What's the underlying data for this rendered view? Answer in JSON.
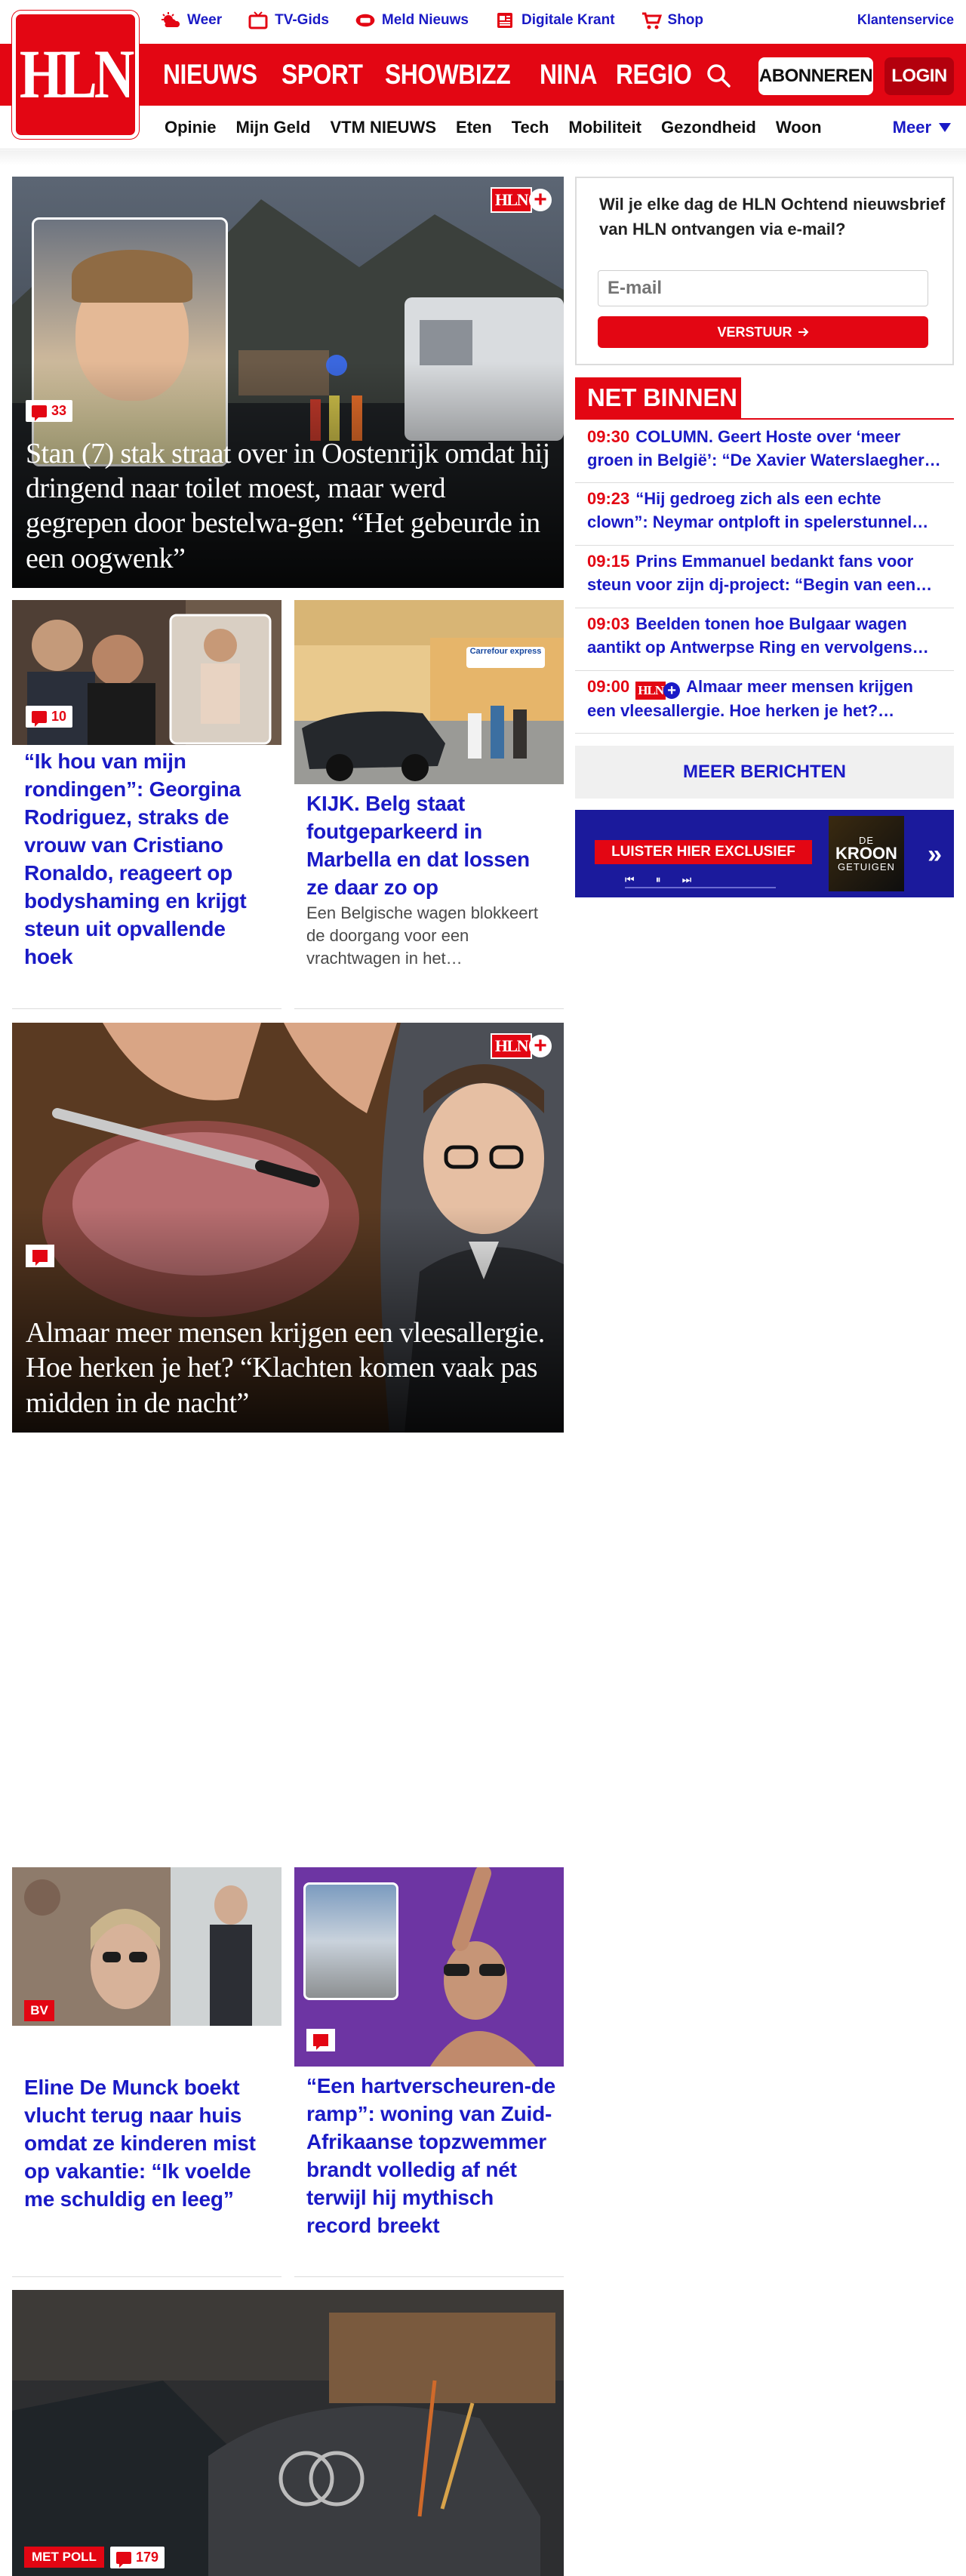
{
  "colors": {
    "brand_red": "#e30613",
    "link_blue": "#1a1ac6"
  },
  "header": {
    "toplinks": [
      {
        "label": "Weer",
        "icon": "weather-icon"
      },
      {
        "label": "TV-Gids",
        "icon": "tv-icon"
      },
      {
        "label": "Meld Nieuws",
        "icon": "report-news-icon"
      },
      {
        "label": "Digitale Krant",
        "icon": "newspaper-icon"
      },
      {
        "label": "Shop",
        "icon": "cart-icon"
      }
    ],
    "klantenservice": "Klantenservice",
    "logo": "HLN",
    "main_nav": [
      "NIEUWS",
      "SPORT",
      "SHOWBIZZ",
      "NINA",
      "REGIO"
    ],
    "abonneren": "ABONNEREN",
    "login": "LOGIN",
    "sub_nav": [
      "Opinie",
      "Mijn Geld",
      "VTM NIEUWS",
      "Eten",
      "Tech",
      "Mobiliteit",
      "Gezondheid",
      "Woon"
    ],
    "meer": "Meer"
  },
  "articles": {
    "hero1": {
      "title": "Stan (7) stak straat over in Oostenrijk omdat hij dringend naar toilet moest, maar werd gegrepen door bestelwa-gen: “Het gebeurde in een oogwenk”",
      "comments": "33",
      "plus": "HLN"
    },
    "georgina": {
      "title": "“Ik hou van mijn rondingen”: Georgina Rodriguez, straks de vrouw van Cristiano Ronaldo, reageert op bodyshaming en krijgt steun uit opvallende hoek",
      "comments": "10"
    },
    "belg": {
      "title": "KIJK. Belg staat foutgeparkeerd in Marbella en dat lossen ze daar zo op",
      "lead": "Een Belgische wagen blokkeert de doorgang voor een vrachtwagen in het…",
      "store_sign": "Carrefour express"
    },
    "hero2": {
      "title": "Almaar meer mensen krijgen een vleesallergie. Hoe herken je het? “Klachten komen vaak pas midden in de nacht”",
      "plus": "HLN"
    },
    "eline": {
      "title": "Eline De Munck boekt vlucht terug naar huis omdat ze kinderen mist op vakantie: “Ik voelde me schuldig en leeg”",
      "badge": "BV"
    },
    "zwemmer": {
      "title": "“Een hartverscheuren-de ramp”: woning van Zuid-Afrikaanse topzwemmer brandt volledig af nét terwijl hij mythisch record breekt"
    },
    "crash": {
      "poll": "MET POLL",
      "comments": "179"
    }
  },
  "sidebar": {
    "newsletter": {
      "question": "Wil je elke dag de HLN Ochtend nieuwsbrief van HLN ontvangen via e-mail?",
      "placeholder": "E-mail",
      "button": "VERSTUUR"
    },
    "net_binnen": {
      "title": "NET BINNEN",
      "items": [
        {
          "time": "09:30",
          "text": "COLUMN. Geert Hoste over ‘meer groen in België’: “De Xavier Waterslaegher…"
        },
        {
          "time": "09:23",
          "text": "“Hij gedroeg zich als een echte clown”: Neymar ontploft in spelerstunnel e…"
        },
        {
          "time": "09:15",
          "text": "Prins Emmanuel bedankt fans voor steun voor zijn dj-project: “Begin van een…"
        },
        {
          "time": "09:03",
          "text": "Beelden tonen hoe Bulgaar wagen aantikt op Antwerpse Ring en vervolgens…"
        },
        {
          "time": "09:00",
          "text": "Almaar meer mensen krijgen een vleesallergie. Hoe herken je het?…",
          "plus": "HLN"
        }
      ],
      "more": "MEER BERICHTEN"
    },
    "podcast": {
      "listen": "LUISTER HIER EXCLUSIEF",
      "brand_small": "DE",
      "brand_top": "KROON",
      "brand_bottom": "GETUIGEN",
      "chevron": "»"
    }
  }
}
